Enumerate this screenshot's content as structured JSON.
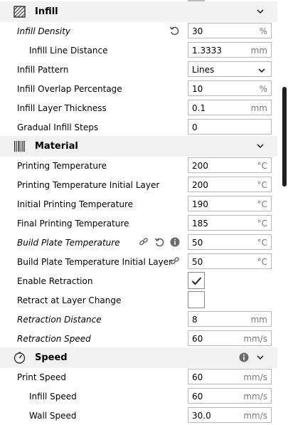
{
  "sections": {
    "infill": {
      "title": "Infill",
      "rows": {
        "infill_density": {
          "label": "Infill Density",
          "value": "30",
          "unit": "%"
        },
        "infill_line_distance": {
          "label": "Infill Line Distance",
          "value": "1.3333",
          "unit": "mm"
        },
        "infill_pattern": {
          "label": "Infill Pattern",
          "value": "Lines"
        },
        "infill_overlap": {
          "label": "Infill Overlap Percentage",
          "value": "10",
          "unit": "%"
        },
        "infill_layer_thickness": {
          "label": "Infill Layer Thickness",
          "value": "0.1",
          "unit": "mm"
        },
        "gradual_infill_steps": {
          "label": "Gradual Infill Steps",
          "value": "0"
        }
      }
    },
    "material": {
      "title": "Material",
      "rows": {
        "printing_temp": {
          "label": "Printing Temperature",
          "value": "200",
          "unit": "°C"
        },
        "printing_temp_initial": {
          "label": "Printing Temperature Initial Layer",
          "value": "200",
          "unit": "°C"
        },
        "initial_printing_temp": {
          "label": "Initial Printing Temperature",
          "value": "190",
          "unit": "°C"
        },
        "final_printing_temp": {
          "label": "Final Printing Temperature",
          "value": "185",
          "unit": "°C"
        },
        "build_plate_temp": {
          "label": "Build Plate Temperature",
          "value": "50",
          "unit": "°C"
        },
        "build_plate_temp_initial": {
          "label": "Build Plate Temperature Initial Layer",
          "value": "50",
          "unit": "°C"
        },
        "enable_retraction": {
          "label": "Enable Retraction",
          "checked": true
        },
        "retract_layer_change": {
          "label": "Retract at Layer Change",
          "checked": false
        },
        "retraction_distance": {
          "label": "Retraction Distance",
          "value": "8",
          "unit": "mm"
        },
        "retraction_speed": {
          "label": "Retraction Speed",
          "value": "60",
          "unit": "mm/s"
        }
      }
    },
    "speed": {
      "title": "Speed",
      "rows": {
        "print_speed": {
          "label": "Print Speed",
          "value": "60",
          "unit": "mm/s"
        },
        "infill_speed": {
          "label": "Infill Speed",
          "value": "60",
          "unit": "mm/s"
        },
        "wall_speed": {
          "label": "Wall Speed",
          "value": "30.0",
          "unit": "mm/s"
        }
      }
    }
  },
  "icons": {
    "infill_section": "infill-hatch-icon",
    "material_section": "material-barcode-icon",
    "speed_section": "speed-gauge-icon",
    "reset": "reset-icon",
    "link": "link-icon",
    "info": "info-icon",
    "collapse": "chevron-down-icon"
  },
  "colors": {
    "header_bg": "#f2f2f2",
    "field_border": "#b8b8b8",
    "unit_text": "#7a7a7a",
    "scrollbar": "#1f1f1f"
  }
}
